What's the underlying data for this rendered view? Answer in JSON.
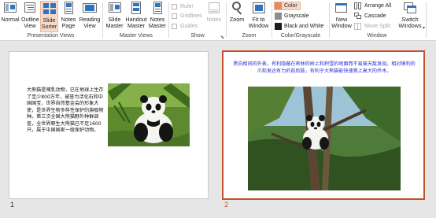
{
  "ribbon": {
    "presentation_views": {
      "label": "Presentation Views",
      "buttons": [
        "Normal",
        "Outline View",
        "Slide Sorter",
        "Notes Page",
        "Reading View"
      ]
    },
    "master_views": {
      "label": "Master Views",
      "buttons": [
        "Slide Master",
        "Handout Master",
        "Notes Master"
      ]
    },
    "show": {
      "label": "Show",
      "checkboxes": [
        "Ruler",
        "Gridlines",
        "Guides"
      ],
      "notes_button": "Notes"
    },
    "zoom": {
      "label": "Zoom",
      "buttons": [
        "Zoom",
        "Fit to Window"
      ]
    },
    "color_grayscale": {
      "label": "Color/Grayscale",
      "options": [
        "Color",
        "Grayscale",
        "Black and White"
      ]
    },
    "window": {
      "label": "Window",
      "new_window": "New Window",
      "items": [
        "Arrange All",
        "Cascade",
        "Move Split"
      ],
      "switch_windows": "Switch Windows"
    }
  },
  "slides": [
    {
      "number": "1",
      "text": "大熊猫是哺乳动物，已在地球上生存了至少800万年，被誉为活化石和中国国宝，世界自然基金会的形象大使，是世界生物多样性保护的旗舰物种。第三次全国大熊猫野外种群调查，全世界野生大熊猫已不足1600只，属于中国国家一级保护动物。"
    },
    {
      "number": "2",
      "text": "黑白相间的外表，有利隐蔽在密林的树上和积雪的地面而不易被天敌发现。相对锋利的爪和发达有力的前后肢，有利于大熊猫能快速爬上高大的乔木。"
    }
  ]
}
